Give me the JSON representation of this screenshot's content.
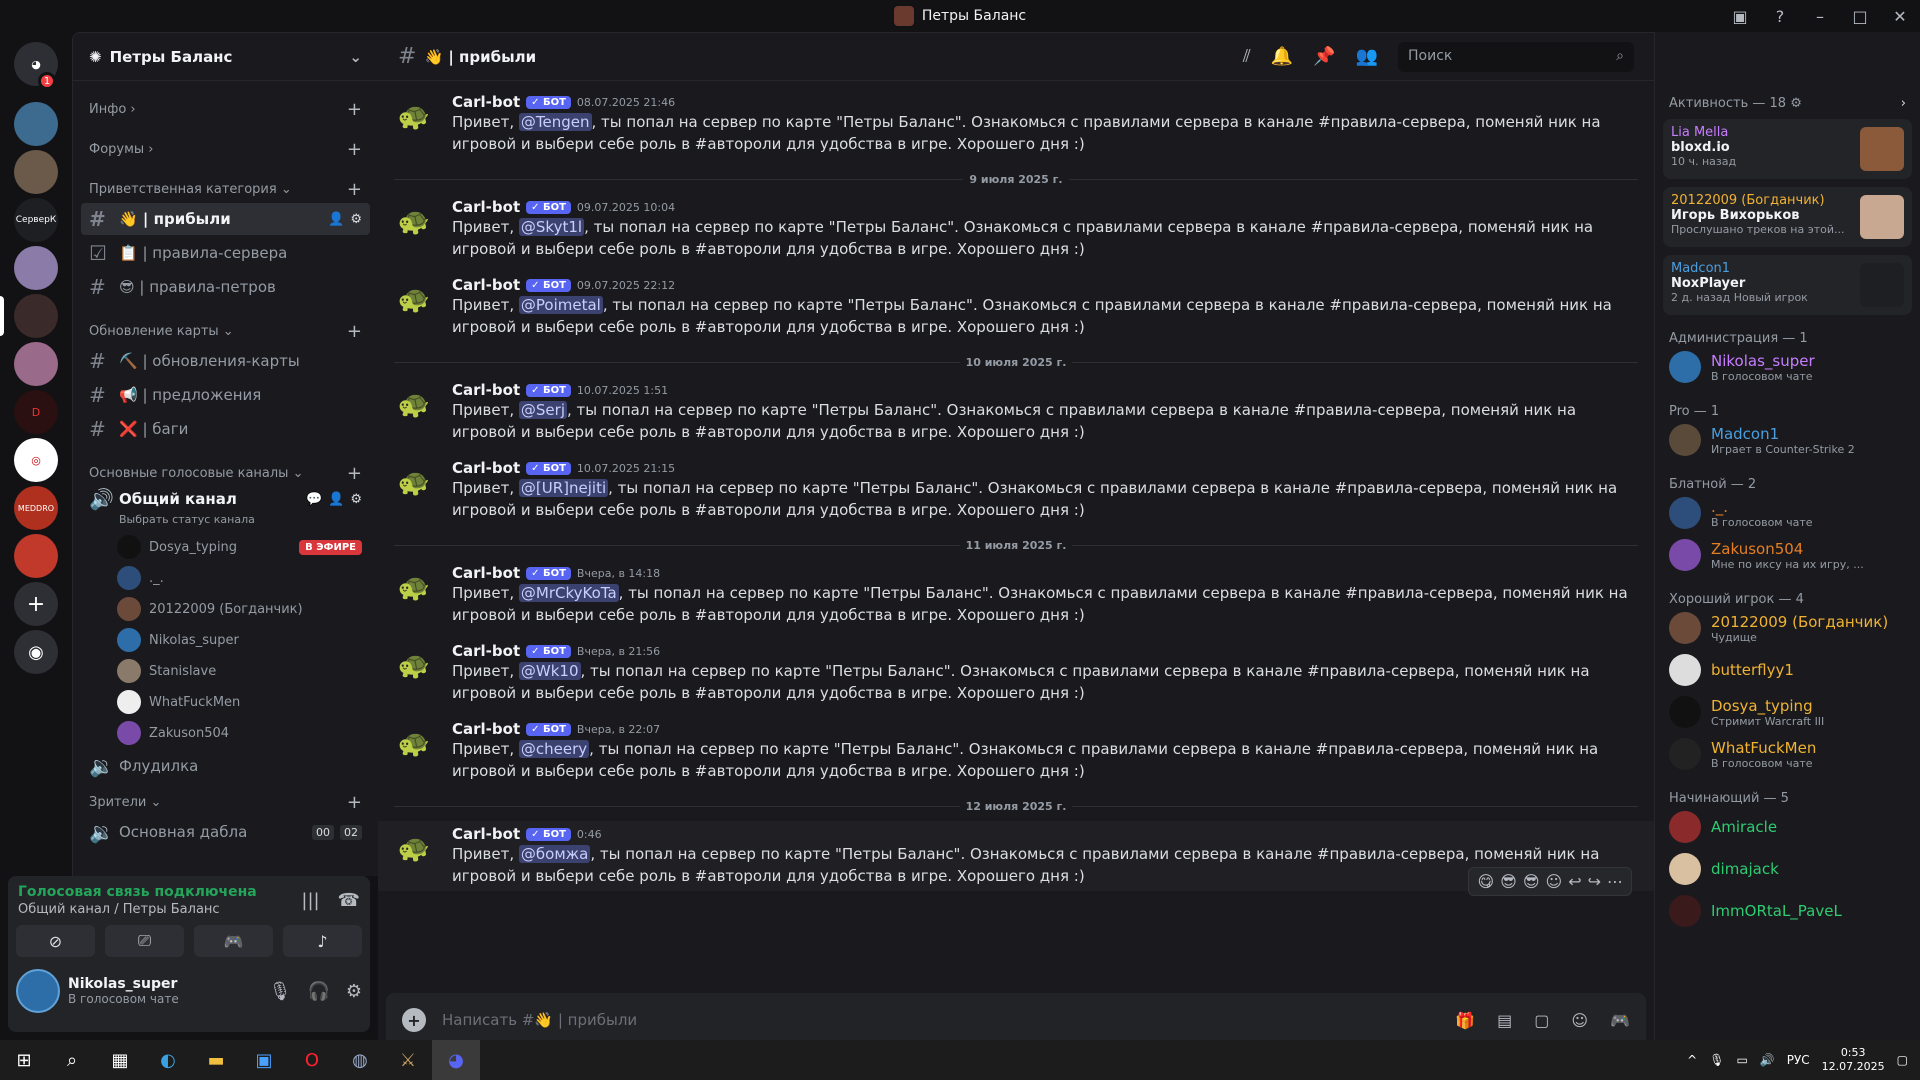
{
  "window": {
    "title": "Петры Баланс"
  },
  "server": {
    "name": "Петры Баланс"
  },
  "categories": {
    "info": "Инфо",
    "forums": "Форумы",
    "welcome": "Приветственная категория",
    "updates": "Обновление карты",
    "voice": "Основные голосовые каналы",
    "viewers": "Зрители"
  },
  "channels": {
    "pribyli": "👋 | прибыли",
    "rules": "📋 | правила-сервера",
    "rules_petrov": "😎 | правила-петров",
    "map_updates": "⛏️ | обновления-карты",
    "proposals": "📢 | предложения",
    "bugs": "❌ | баги",
    "general_voice": "Общий канал",
    "general_status": "Выбрать статус канала",
    "fludilka": "Флудилка",
    "main_dabla": "Основная дабла",
    "dabla_counts": [
      "00",
      "02"
    ]
  },
  "voice_users": [
    {
      "name": "Dosya_typing",
      "badge": "В ЭФИРЕ"
    },
    {
      "name": "._."
    },
    {
      "name": "20122009 (Богданчик)"
    },
    {
      "name": "Nikolas_super"
    },
    {
      "name": "Stanislave"
    },
    {
      "name": "WhatFuckMen"
    },
    {
      "name": "Zakuson504"
    }
  ],
  "voice_panel": {
    "status": "Голосовая связь подключена",
    "location": "Общий канал / Петры Баланс",
    "user_name": "Nikolas_super",
    "user_status": "В голосовом чате"
  },
  "header": {
    "channel": "👋 | прибыли",
    "search_placeholder": "Поиск"
  },
  "messages": [
    {
      "author": "Carl-bot",
      "bot": "✓ БОТ",
      "time": "08.07.2025 21:46",
      "pre": "Привет, ",
      "mention": "@Tengen",
      "post": ", ты попал на сервер по карте \"Петры Баланс\". Ознакомься с правилами сервера в канале #правила-сервера, поменяй ник на игровой и выбери себе роль в #автороли для удобства в игре. Хорошего дня :)"
    },
    {
      "divider": "9 июля 2025 г."
    },
    {
      "author": "Carl-bot",
      "bot": "✓ БОТ",
      "time": "09.07.2025 10:04",
      "pre": "Привет, ",
      "mention": "@Skyt1l",
      "post": ", ты попал на сервер по карте \"Петры Баланс\". Ознакомься с правилами сервера в канале #правила-сервера, поменяй ник на игровой и выбери себе роль в #автороли для удобства в игре. Хорошего дня :)"
    },
    {
      "author": "Carl-bot",
      "bot": "✓ БОТ",
      "time": "09.07.2025 22:12",
      "pre": "Привет, ",
      "mention": "@Poimetal",
      "post": ", ты попал на сервер по карте \"Петры Баланс\". Ознакомься с правилами сервера в канале #правила-сервера, поменяй ник на игровой и выбери себе роль в #автороли для удобства в игре. Хорошего дня :)"
    },
    {
      "divider": "10 июля 2025 г."
    },
    {
      "author": "Carl-bot",
      "bot": "✓ БОТ",
      "time": "10.07.2025 1:51",
      "pre": "Привет, ",
      "mention": "@Serj",
      "post": ", ты попал на сервер по карте \"Петры Баланс\". Ознакомься с правилами сервера в канале #правила-сервера, поменяй ник на игровой и выбери себе роль в #автороли для удобства в игре. Хорошего дня :)"
    },
    {
      "author": "Carl-bot",
      "bot": "✓ БОТ",
      "time": "10.07.2025 21:15",
      "pre": "Привет, ",
      "mention": "@[UR]nejiti",
      "post": ", ты попал на сервер по карте \"Петры Баланс\". Ознакомься с правилами сервера в канале #правила-сервера, поменяй ник на игровой и выбери себе роль в #автороли для удобства в игре. Хорошего дня :)"
    },
    {
      "divider": "11 июля 2025 г."
    },
    {
      "author": "Carl-bot",
      "bot": "✓ БОТ",
      "time": "Вчера, в 14:18",
      "pre": "Привет, ",
      "mention": "@MrCkyKoTa",
      "post": ", ты попал на сервер по карте \"Петры Баланс\". Ознакомься с правилами сервера в канале #правила-сервера, поменяй ник на игровой и выбери себе роль в #автороли для удобства в игре. Хорошего дня :)"
    },
    {
      "author": "Carl-bot",
      "bot": "✓ БОТ",
      "time": "Вчера, в 21:56",
      "pre": "Привет, ",
      "mention": "@Wk10",
      "post": ", ты попал на сервер по карте \"Петры Баланс\". Ознакомься с правилами сервера в канале #правила-сервера, поменяй ник на игровой и выбери себе роль в #автороли для удобства в игре. Хорошего дня :)"
    },
    {
      "author": "Carl-bot",
      "bot": "✓ БОТ",
      "time": "Вчера, в 22:07",
      "pre": "Привет, ",
      "mention": "@cheery",
      "post": ", ты попал на сервер по карте \"Петры Баланс\". Ознакомься с правилами сервера в канале #правила-сервера, поменяй ник на игровой и выбери себе роль в #автороли для удобства в игре. Хорошего дня :)"
    },
    {
      "divider": "12 июля 2025 г."
    },
    {
      "author": "Carl-bot",
      "bot": "✓ БОТ",
      "time": "0:46",
      "pre": "Привет, ",
      "mention": "@бомжа",
      "post": ", ты попал на сервер по карте \"Петры Баланс\". Ознакомься с правилами сервера в канале #правила-сервера, поменяй ник на игровой и выбери себе роль в #автороли для удобства в игре. Хорошего дня :)"
    }
  ],
  "composer": {
    "placeholder": "Написать #👋 | прибыли"
  },
  "members": {
    "activity_title": "Активность — 18",
    "activities": [
      {
        "name": "Lia Mella",
        "game": "bloxd.io",
        "status": "10 ч. назад",
        "color": "#c77dff"
      },
      {
        "name": "20122009 (Богданчик)",
        "game": "Игорь Вихорьков",
        "status": "Прослушано треков на этой...",
        "color": "#f0b232"
      },
      {
        "name": "Madcon1",
        "game": "NoxPlayer",
        "status": "2 д. назад   Новый игрок",
        "color": "#4a9fe0"
      }
    ],
    "groups": [
      {
        "role": "Администрация — 1",
        "items": [
          {
            "name": "Nikolas_super",
            "status": "В голосовом чате",
            "color": "#c77dff"
          }
        ]
      },
      {
        "role": "Pro — 1",
        "items": [
          {
            "name": "Madcon1",
            "status": "Играет в Counter-Strike 2",
            "color": "#4a9fe0"
          }
        ]
      },
      {
        "role": "Блатной — 2",
        "items": [
          {
            "name": "._.",
            "status": "В голосовом чате",
            "color": "#e67e22"
          },
          {
            "name": "Zakuson504",
            "status": "Мне по иксу на их игру, ...",
            "color": "#e67e22"
          }
        ]
      },
      {
        "role": "Хороший игрок — 4",
        "items": [
          {
            "name": "20122009 (Богданчик)",
            "status": "Чудище",
            "color": "#f0b232"
          },
          {
            "name": "butterflyy1",
            "status": "",
            "color": "#f0b232"
          },
          {
            "name": "Dosya_typing",
            "status": "Стримит Warcraft III",
            "color": "#f0b232"
          },
          {
            "name": "WhatFuckMen",
            "status": "В голосовом чате",
            "color": "#f0b232"
          }
        ]
      },
      {
        "role": "Начинающий — 5",
        "items": [
          {
            "name": "Amiracle",
            "status": "",
            "color": "#2ecc71"
          },
          {
            "name": "dimajack",
            "status": "",
            "color": "#2ecc71"
          },
          {
            "name": "ImmORtaL_PaveL",
            "status": "",
            "color": "#2ecc71"
          }
        ]
      }
    ]
  },
  "taskbar": {
    "lang": "РУС",
    "time": "0:53",
    "date": "12.07.2025"
  },
  "colors": {
    "accent": "#5865f2",
    "online": "#23a55a",
    "live": "#da373c"
  },
  "icons": [
    "discord-icon",
    "search-icon",
    "gear-icon",
    "bell-icon",
    "pin-icon",
    "members-icon",
    "plus-icon",
    "mic-icon",
    "headphones-icon",
    "hangup-icon",
    "gift-icon",
    "gif-icon",
    "sticker-icon",
    "emoji-icon",
    "gamepad-icon"
  ]
}
